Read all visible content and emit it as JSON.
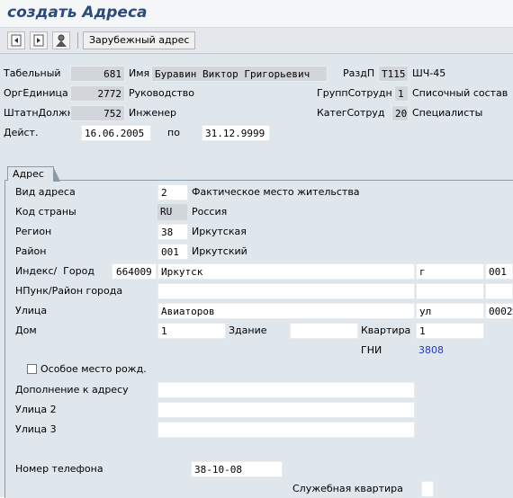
{
  "title": "создать Адреса",
  "toolbar": {
    "foreign_address_label": "Зарубежный адрес"
  },
  "header": {
    "personnel_no": {
      "label": "Табельный",
      "value": "681"
    },
    "name": {
      "label": "Имя",
      "value": "Буравин Виктор Григорьевич"
    },
    "pers_area": {
      "label": "РаздП",
      "code": "T115",
      "text": "ШЧ-45"
    },
    "org_unit": {
      "label": "ОргЕдиница",
      "value": "2772",
      "text": "Руководство"
    },
    "emp_group": {
      "label": "ГруппСотрудн",
      "code": "1",
      "text": "Списочный состав"
    },
    "position": {
      "label": "ШтатнДолжн",
      "value": "752",
      "text": "Инженер"
    },
    "emp_subgroup": {
      "label": "КатегСотруд",
      "code": "20",
      "text": "Специалисты"
    },
    "valid": {
      "label": "Дейст.",
      "from": "16.06.2005",
      "to_label": "по",
      "to": "31.12.9999"
    }
  },
  "tab": {
    "label": "Адрес"
  },
  "form": {
    "address_type": {
      "label": "Вид адреса",
      "value": "2",
      "text": "Фактическое место жительства"
    },
    "country": {
      "label": "Код страны",
      "value": "RU",
      "text": "Россия"
    },
    "region": {
      "label": "Регион",
      "value": "38",
      "text": "Иркутская"
    },
    "district": {
      "label": "Район",
      "value": "001",
      "text": "Иркутский"
    },
    "postcode_city": {
      "label": "Индекс/  Город",
      "postcode": "664009",
      "city": "Иркутск",
      "type": "г",
      "code": "001"
    },
    "locality": {
      "label": "НПунк/Район города",
      "value": ""
    },
    "street": {
      "label": "Улица",
      "value": "Авиаторов",
      "type": "ул",
      "code": "0002"
    },
    "house": {
      "label": "Дом",
      "value": "1",
      "building_label": "Здание",
      "building": "",
      "apartment_label": "Квартира",
      "apartment": "1"
    },
    "gni": {
      "label": "ГНИ",
      "value": "3808"
    },
    "special_birthplace": {
      "label": "Особое место рожд.",
      "checked": false
    },
    "addition": {
      "label": "Дополнение к адресу",
      "value": ""
    },
    "street2": {
      "label": "Улица 2",
      "value": ""
    },
    "street3": {
      "label": "Улица 3",
      "value": ""
    },
    "phone": {
      "label": "Номер телефона",
      "value": "38-10-08"
    },
    "service_apartment": {
      "label": "Служебная квартира",
      "value": ""
    }
  },
  "colors": {
    "title": "#2c4a7c",
    "gni_value": "#1a3cc8",
    "background": "#dfe6ec"
  },
  "icons": [
    "back-icon",
    "forward-icon",
    "person-search-icon"
  ]
}
